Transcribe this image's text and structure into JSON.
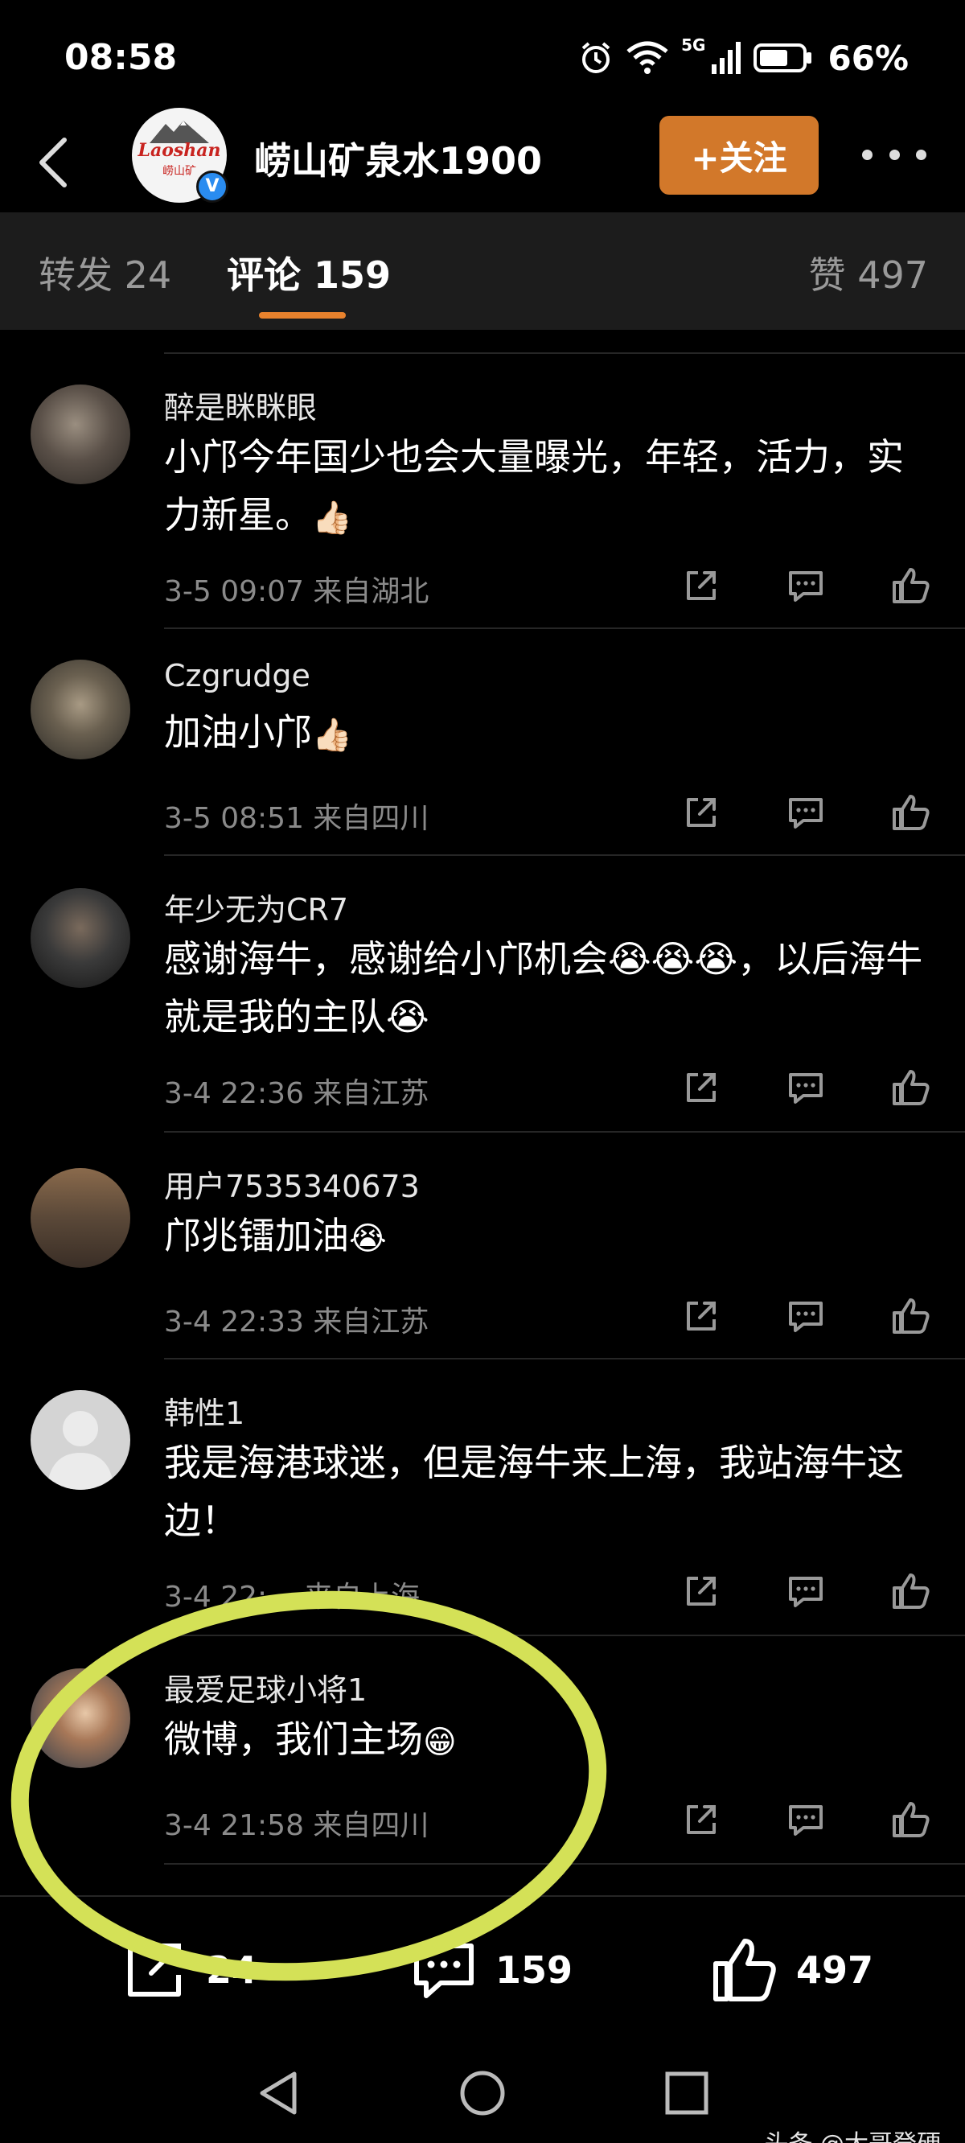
{
  "status_bar": {
    "time": "08:58",
    "network": "5G",
    "battery": "66%"
  },
  "header": {
    "account_name": "崂山矿泉水1900",
    "brand_logo_text": "Laoshan",
    "brand_logo_sub": "崂山矿",
    "verified_mark": "V",
    "follow_label": "+关注"
  },
  "tabs": {
    "repost": "转发 24",
    "comments": "评论 159",
    "likes": "赞 497"
  },
  "comments": [
    {
      "name": "醉是眯眯眼",
      "text": "小邝今年国少也会大量曝光，年轻，活力，实力新星。",
      "emoji": "👍🏻",
      "meta": "3-5 09:07  来自湖北"
    },
    {
      "name": "Czgrudge",
      "text": "加油小邝",
      "emoji": "👍🏻",
      "meta": "3-5 08:51  来自四川"
    },
    {
      "name": "年少无为CR7",
      "text": "感谢海牛，感谢给小邝机会😭😭😭，以后海牛就是我的主队😭",
      "emoji": "",
      "meta": "3-4 22:36  来自江苏"
    },
    {
      "name": "用户7535340673",
      "text": "邝兆镭加油",
      "emoji": "😭",
      "meta": "3-4 22:33  来自江苏"
    },
    {
      "name": "韩性1",
      "text": "我是海港球迷，但是海牛来上海，我站海牛这边！",
      "emoji": "",
      "meta": "3-4 22:... 来自上海"
    },
    {
      "name": "最爱足球小将1",
      "text": "微博，我们主场",
      "emoji": "😁",
      "meta": "3-4 21:58  来自四川"
    }
  ],
  "bottom_bar": {
    "repost_count": "24",
    "comment_count": "159",
    "like_count": "497"
  },
  "watermark": "头条 @大哥登硬",
  "colors": {
    "accent": "#e8822d",
    "follow": "#d2782a",
    "annotation": "#d4e157"
  }
}
